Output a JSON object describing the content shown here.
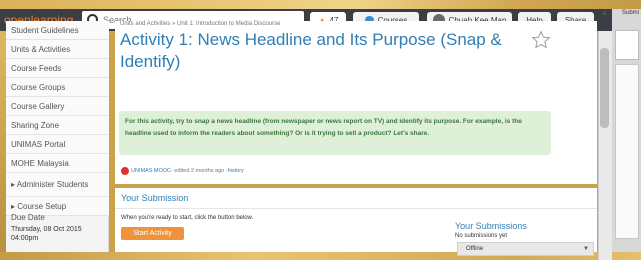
{
  "brand": "openlearning",
  "search": {
    "placeholder": "Search"
  },
  "header": {
    "points": "47",
    "courses_label": "Courses",
    "user_name": "Chuah Kee Man",
    "help_label": "Help",
    "share_label": "Share"
  },
  "side_panel": {
    "label": "Submi"
  },
  "sidebar": {
    "items": [
      "Student Guidelines",
      "Units & Activities",
      "Course Feeds",
      "Course Groups",
      "Course Gallery",
      "Sharing Zone",
      "UNIMAS Portal",
      "MOHE Malaysia",
      "▸ Administer Students",
      "▸ Course Setup"
    ],
    "due_heading": "Due Date",
    "due_value": "Thursday, 08 Oct 2015 04:00pm"
  },
  "main": {
    "breadcrumb": "Units and Activities » Unit 1: Introduction to Media Discourse",
    "title": "Activity 1: News Headline and Its Purpose (Snap & Identify)",
    "instruction": "For this activity, try to snap a news headline (from newspaper or news report on TV) and identify its purpose. For example, is the headline used to inform the readers about something? Or is it trying to sell a product? Let's share.",
    "meta_author": "UNIMAS MOOC",
    "meta_rest": " - edited 2 months ago - ",
    "meta_history": "history"
  },
  "submission": {
    "title": "Your Submission",
    "prompt": "When you're ready to start, click the button below.",
    "start_button": "Start Activity",
    "list_title": "Your Submissions",
    "list_empty": "No submissions yet",
    "mode_select": "Offline"
  },
  "colors": {
    "accent": "#2f7fb5",
    "brand": "#f07f2a",
    "notice_bg": "#dff0d8"
  }
}
